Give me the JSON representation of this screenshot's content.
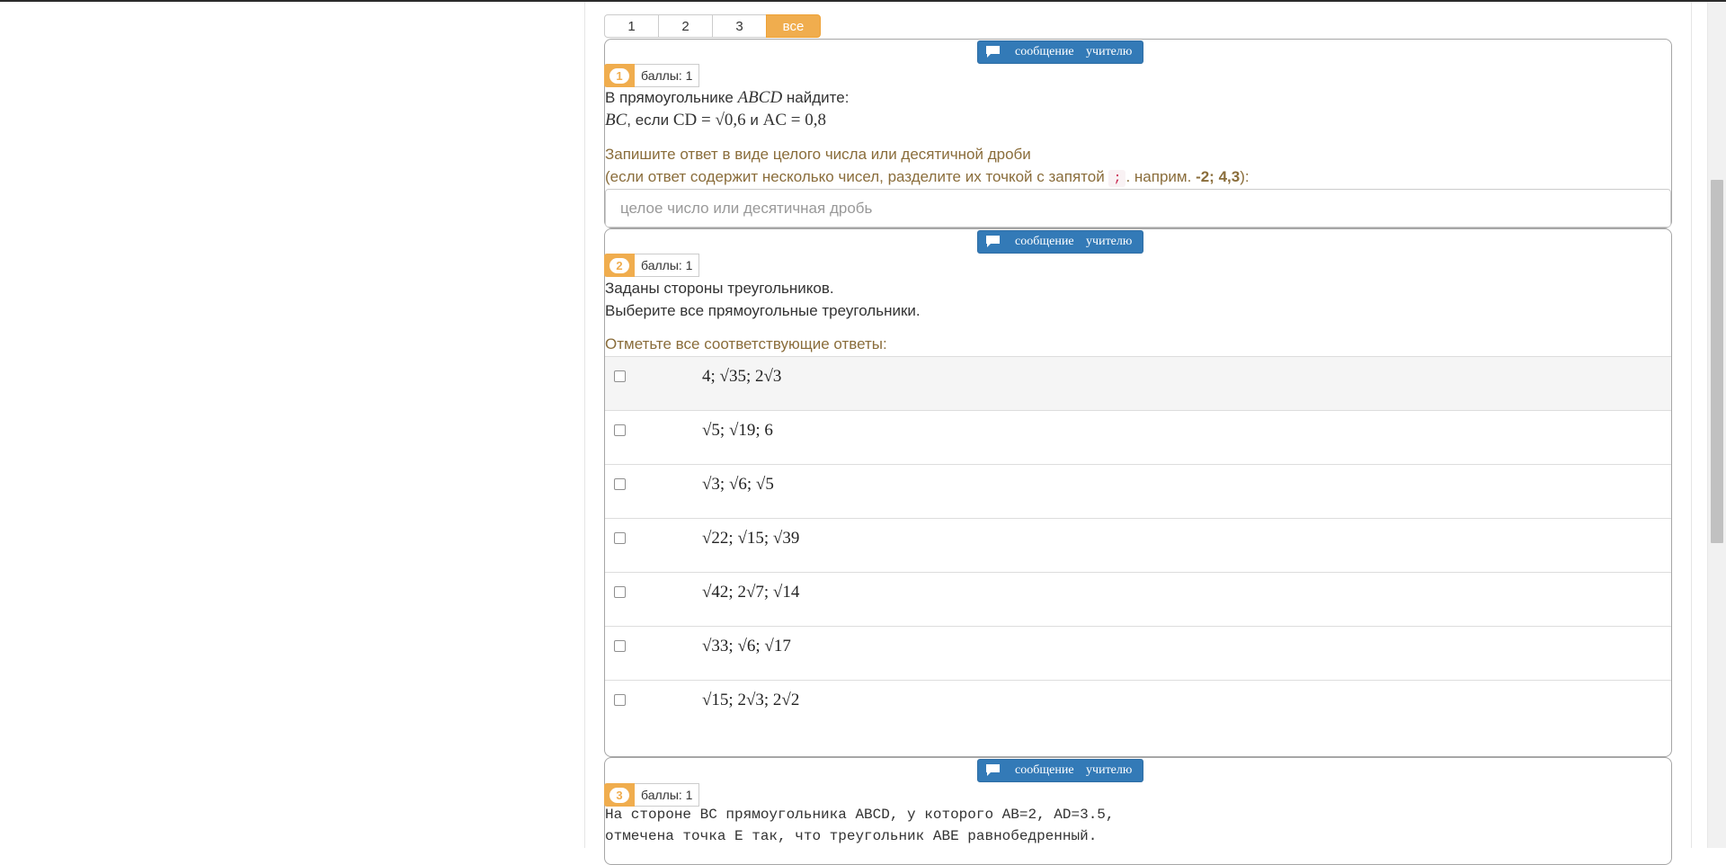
{
  "pager": {
    "pages": [
      "1",
      "2",
      "3",
      "все"
    ],
    "active": "все"
  },
  "message_button": {
    "label": "сообщение учителю"
  },
  "questions": [
    {
      "number": "1",
      "score": "баллы: 1",
      "line1_prefix": "В прямоугольнике",
      "line1_math": "ABCD",
      "line1_suffix": "найдите:",
      "line2_a": "BC",
      "line2_comma": ", если",
      "line2_b": "CD = √0,6",
      "line2_and": "и",
      "line2_c": "AC = 0,8",
      "hint1": "Запишите ответ в виде целого числа или десятичной дроби",
      "hint2_prefix": "(если ответ содержит несколько чисел, разделите их точкой с запятой",
      "hint2_code": ";",
      "hint2_mid": ". наприм.",
      "hint2_example": "-2; 4,3",
      "hint2_suffix": "):",
      "input_placeholder": "целое число или десятичная дробь",
      "input_value": ""
    },
    {
      "number": "2",
      "score": "баллы: 1",
      "line1": "Заданы стороны треугольников.",
      "line2": "Выберите все прямоугольные треугольники.",
      "hint": "Отметьте все соответствующие ответы:",
      "options": [
        "4; √35; 2√3",
        "√5; √19; 6",
        "√3; √6; √5",
        "√22; √15; √39",
        "√42; 2√7; √14",
        "√33; √6; √17",
        "√15; 2√3; 2√2"
      ]
    },
    {
      "number": "3",
      "score": "баллы: 1",
      "line1": "На стороне ВС прямоугольника ABCD, у которого AB=2, AD=3.5,",
      "line2": "отмечена точка Е так, что треугольник ABE равнобедренный."
    }
  ],
  "colors": {
    "accent_orange": "#f0ad4e",
    "button_blue": "#337ab7",
    "hint_brown": "#8a6d3b"
  }
}
